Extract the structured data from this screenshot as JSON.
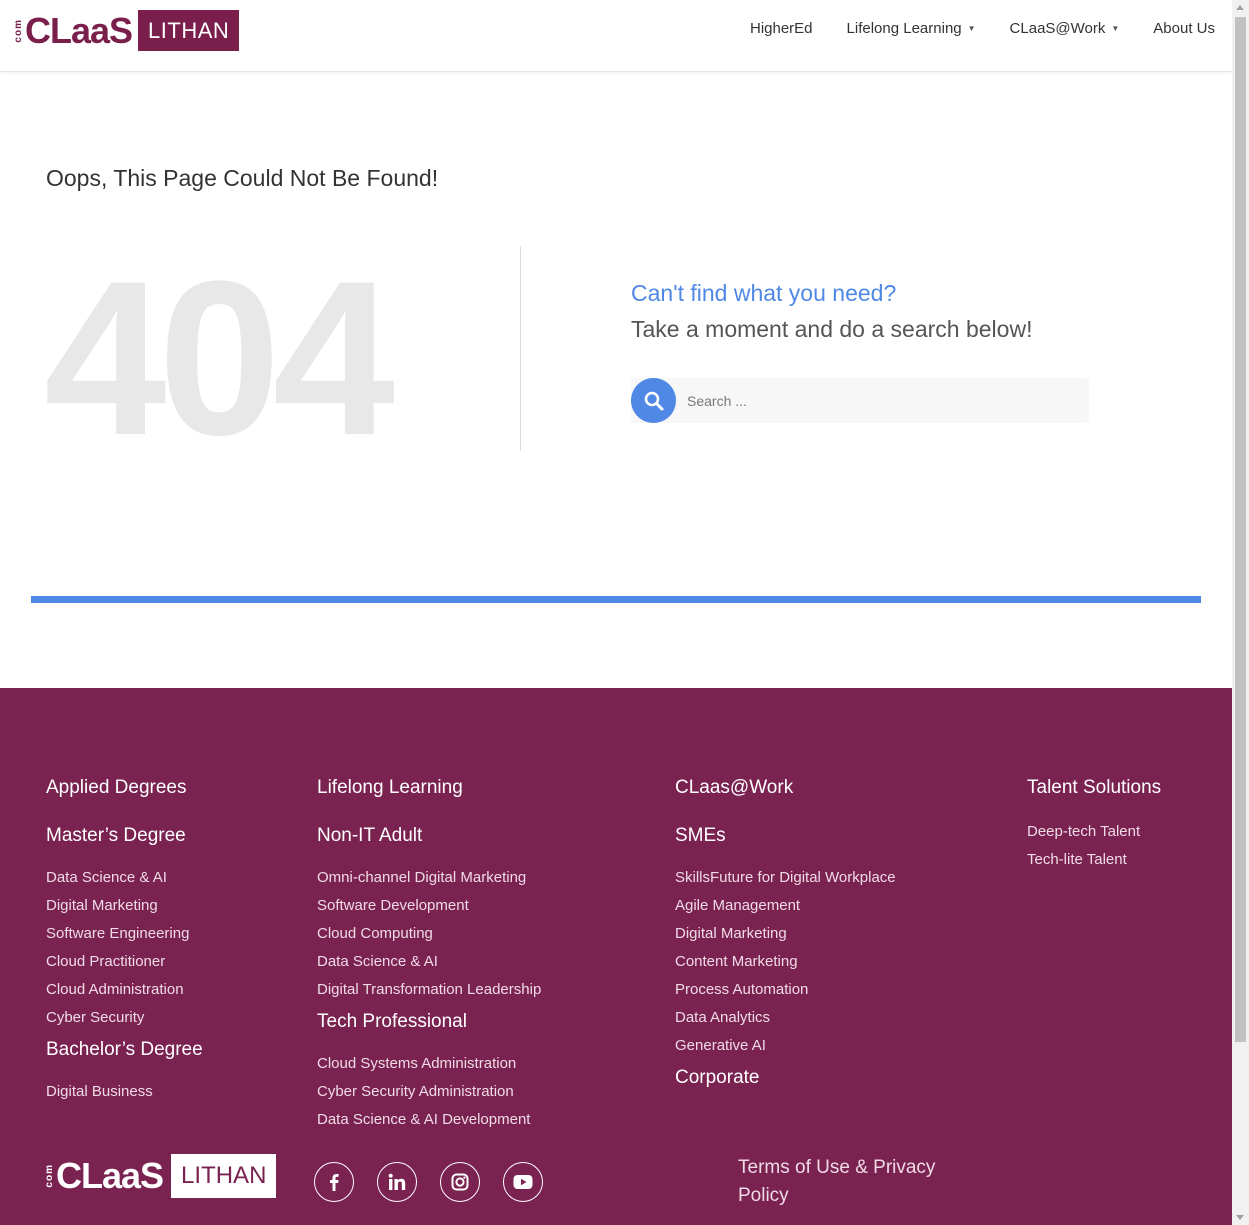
{
  "header": {
    "logo": {
      "com": "com",
      "claas": "CLaaS",
      "lithan": "LITHAN"
    },
    "nav": [
      {
        "label": "HigherEd",
        "dropdown": false
      },
      {
        "label": "Lifelong Learning",
        "dropdown": true
      },
      {
        "label": "CLaaS@Work",
        "dropdown": true
      },
      {
        "label": "About Us",
        "dropdown": false
      }
    ]
  },
  "main": {
    "title": "Oops, This Page Could Not Be Found!",
    "code": "404",
    "cant_find": "Can't find what you need?",
    "take_moment": "Take a moment and do a search below!",
    "search_placeholder": "Search ..."
  },
  "colors": {
    "brand": "#7a1f4c",
    "footer_bg": "#7a2250",
    "accent": "#4f88e5"
  },
  "footer": {
    "col1": {
      "heading": "Applied Degrees",
      "sub1": "Master’s Degree",
      "links1": [
        "Data Science & AI",
        "Digital Marketing",
        "Software Engineering",
        "Cloud Practitioner",
        "Cloud Administration",
        "Cyber Security"
      ],
      "sub2": "Bachelor’s Degree",
      "links2": [
        "Digital Business"
      ]
    },
    "col2": {
      "heading": "Lifelong Learning",
      "sub1": "Non-IT Adult",
      "links1": [
        "Omni-channel Digital Marketing",
        "Software Development",
        "Cloud Computing",
        "Data Science & AI",
        "Digital Transformation Leadership"
      ],
      "sub2": "Tech Professional",
      "links2": [
        "Cloud Systems Administration",
        "Cyber Security Administration",
        "Data Science & AI Development"
      ]
    },
    "col3": {
      "heading": "CLaas@Work",
      "sub1": "SMEs",
      "links1": [
        "SkillsFuture for Digital Workplace",
        "Agile Management",
        "Digital Marketing",
        "Content Marketing",
        "Process Automation",
        "Data Analytics",
        "Generative AI"
      ],
      "sub2": "Corporate"
    },
    "col4": {
      "heading": "Talent Solutions",
      "links1": [
        "Deep-tech Talent",
        "Tech-lite Talent"
      ]
    },
    "logo": {
      "com": "com",
      "claas": "CLaaS",
      "lithan": "LITHAN"
    },
    "socials": [
      "facebook-icon",
      "linkedin-icon",
      "instagram-icon",
      "youtube-icon"
    ],
    "terms": "Terms of Use & Privacy Policy"
  }
}
